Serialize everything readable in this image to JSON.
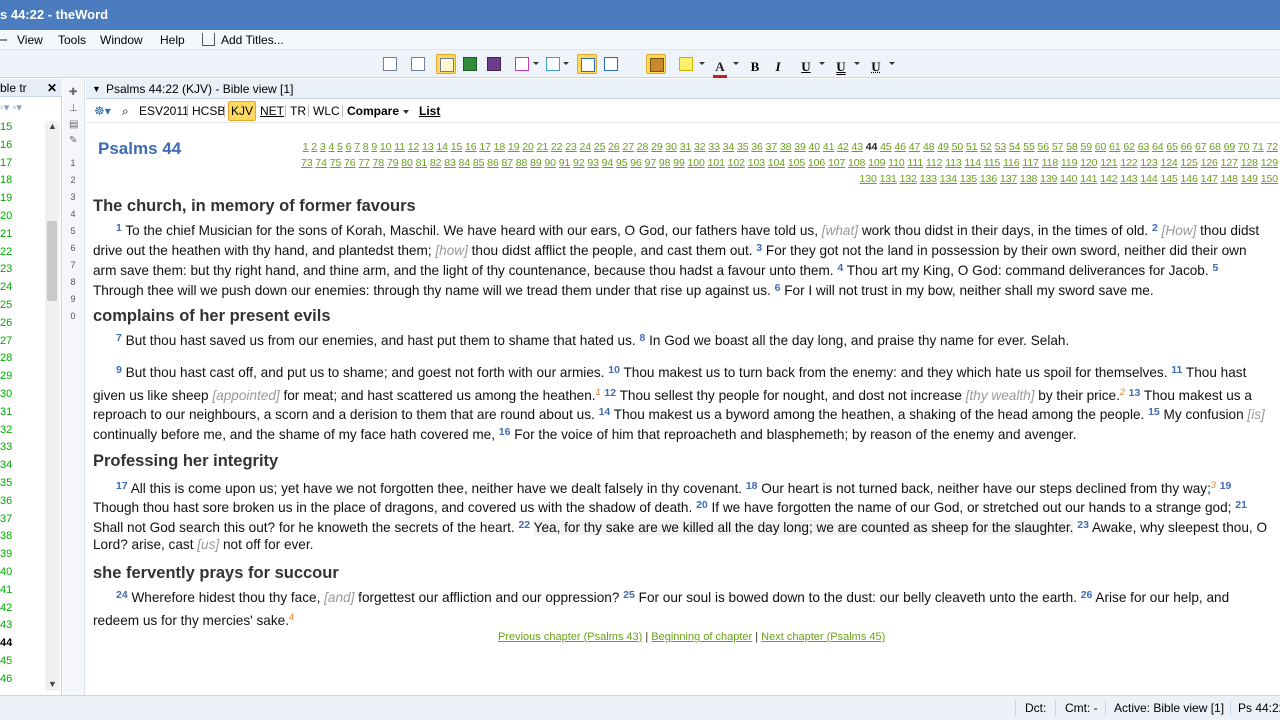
{
  "window": {
    "title": "s 44:22 - theWord"
  },
  "menu": {
    "items": [
      "View",
      "Tools",
      "Window",
      "Help"
    ],
    "add_titles": "Add Titles..."
  },
  "left_panel": {
    "header": "ble tr",
    "rows": [
      "15",
      "16",
      "17",
      "18",
      "19",
      "20",
      "21",
      "22",
      "23",
      "24",
      "25",
      "26",
      "27",
      "28",
      "29",
      "30",
      "31",
      "32",
      "33",
      "34",
      "35",
      "36",
      "37",
      "38",
      "39",
      "40",
      "41",
      "42",
      "43",
      "44",
      "45",
      "46"
    ]
  },
  "gutter": {
    "numbers": [
      "1",
      "2",
      "3",
      "4",
      "5",
      "6",
      "7",
      "8",
      "9",
      "0"
    ]
  },
  "view": {
    "title": "Psalms 44:22 (KJV) - Bible view [1]"
  },
  "bible_bar": {
    "versions": [
      "ESV2011",
      "HCSB",
      "KJV",
      "NET",
      "TR",
      "WLC"
    ],
    "active": "KJV",
    "compare": "Compare",
    "list": "List"
  },
  "chapter": {
    "title": "Psalms 44",
    "current": "44",
    "row1": "1 2 3 4 5 6 7 8 9 10 11 12 13 14 15 16 17 18 19 20 21 22 23 24 25 26 27 28 29 30 31 32 33 34 35 36 37 38 39 40 41 42 43 44 45 46 47 48 49 50 51 52 53 54 55 56 57 58 59 60 61 62 63 64 65 66 67 68 69 70 71 72",
    "row2": "73 74 75 76 77 78 79 80 81 82 83 84 85 86 87 88 89 90 91 92 93 94 95 96 97 98 99 100 101 102 103 104 105 106 107 108 109 110 111 112 113 114 115 116 117 118 119 120 121 122 123 124 125 126 127 128 129",
    "row3": "130 131 132 133 134 135 136 137 138 139 140 141 142 143 144 145 146 147 148 149 150"
  },
  "headings": [
    "The church, in memory of former favours",
    "complains of her present evils",
    "Professing her integrity",
    "she fervently prays for succour"
  ],
  "lines": [
    "To the chief Musician for the sons of Korah, Maschil. We have heard with our ears, O God, our fathers have told us,",
    "work thou didst in their days, in the times of old.",
    "thou didst",
    "drive out the heathen with thy hand, and plantedst them;",
    "thou didst afflict the people, and cast them out.",
    "For they got not the land in possession by their own sword, neither did their own",
    "arm save them: but thy right hand, and thine arm, and the light of thy countenance, because thou hadst a favour unto them.",
    "Thou art my King, O God: command deliverances for Jacob.",
    "Through thee will we push down our enemies: through thy name will we tread them under that rise up against us.",
    "For I will not trust in my bow, neither shall my sword save me.",
    "But thou hast saved us from our enemies, and hast put them to shame that hated us.",
    "In God we boast all the day long, and praise thy name for ever. Selah.",
    "But thou hast cast off, and put us to shame; and goest not forth with our armies.",
    "Thou makest us to turn back from the enemy: and they which hate us spoil for themselves.",
    "Thou hast",
    "given us like sheep",
    "for meat; and hast scattered us among the heathen.",
    "Thou sellest thy people for nought, and dost not increase",
    "by their price.",
    "Thou makest us a",
    "reproach to our neighbours, a scorn and a derision to them that are round about us.",
    "Thou makest us a byword among the heathen, a shaking of the head among the people.",
    "My confusion",
    "continually before me, and the shame of my face hath covered me,",
    "For the voice of him that reproacheth and blasphemeth; by reason of the enemy and avenger.",
    "All this is come upon us; yet have we not forgotten thee, neither have we dealt falsely in thy covenant.",
    "Our heart is not turned back, neither have our steps declined from thy way;",
    "Though thou hast sore broken us in the place of dragons, and covered us with the shadow of death.",
    "If we have forgotten the name of our God, or stretched out our hands to a strange god;",
    "Shall not God search this out? for he knoweth the secrets of the heart.",
    "Yea, for thy sake are we killed all the day long; we are counted as sheep for the slaughter.",
    "Awake, why sleepest thou, O",
    "Lord? arise, cast",
    "not off for ever.",
    "Wherefore hidest thou thy face,",
    "forgettest our affliction and our oppression?",
    "For our soul is bowed down to the dust: our belly cleaveth unto the earth.",
    "Arise for our help, and",
    "redeem us for thy mercies' sake."
  ],
  "italics": [
    "[what]",
    "[How]",
    "[how]",
    "[appointed]",
    "[thy wealth]",
    "[is]",
    "[us]",
    "[and]"
  ],
  "footnotes": [
    "1",
    "2",
    "3",
    "4"
  ],
  "nav": {
    "prev": "Previous chapter (Psalms 43)",
    "begin": "Beginning of chapter",
    "next": "Next chapter (Psalms 45)",
    "sep": "|"
  },
  "status": {
    "dct": "Dct:",
    "cmt": "Cmt: -",
    "active": "Active: Bible view [1]",
    "ref": "Ps 44:22"
  }
}
